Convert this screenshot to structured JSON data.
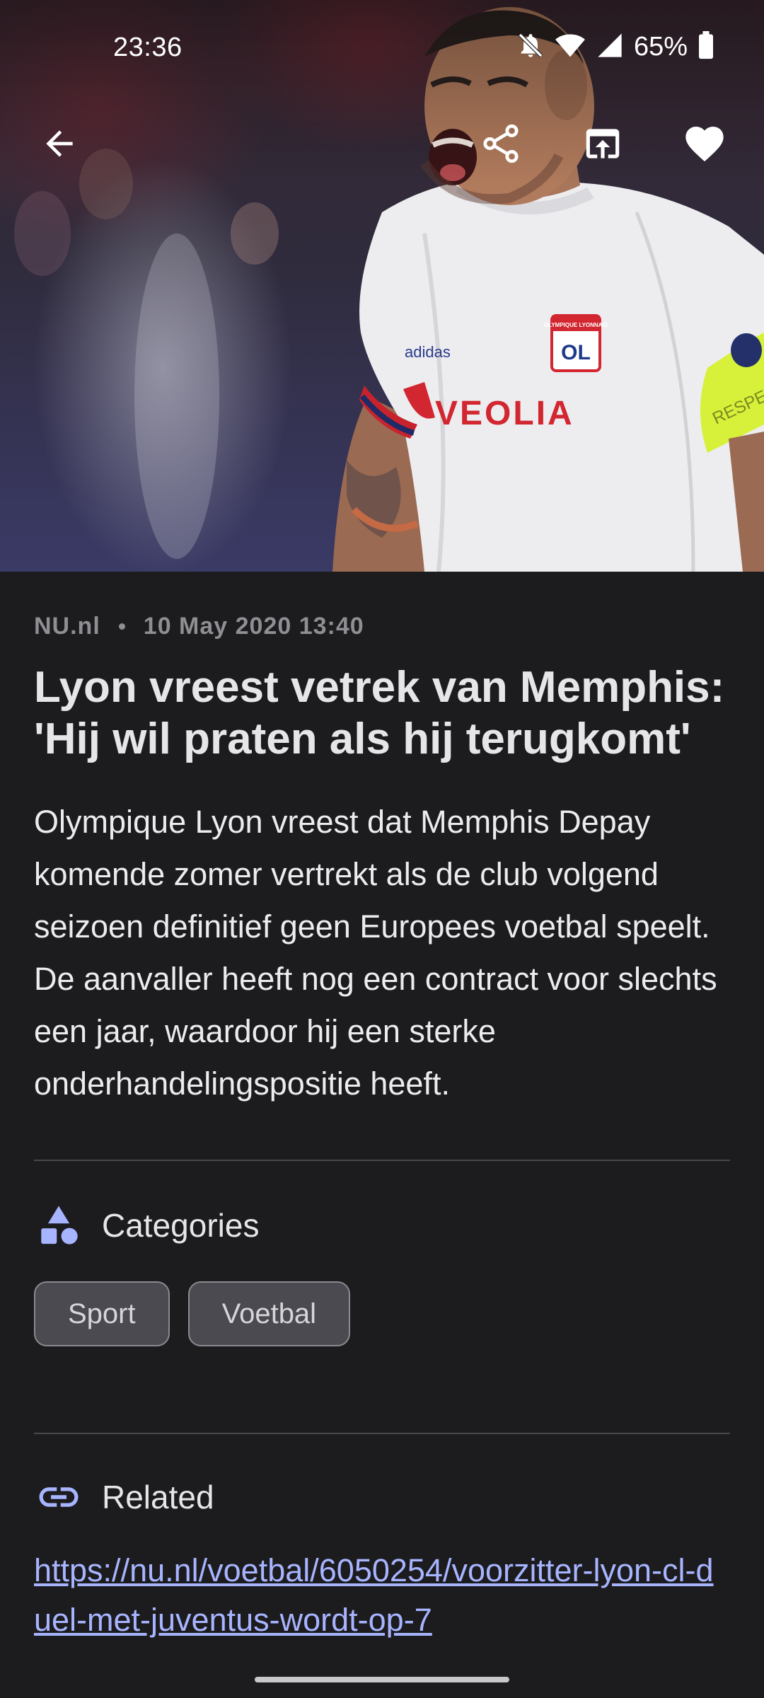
{
  "status_bar": {
    "time": "23:36",
    "battery": "65%",
    "icons": [
      "notifications-off-icon",
      "wifi-icon",
      "cell-signal-icon",
      "battery-icon"
    ]
  },
  "app_bar": {
    "back_icon": "arrow-left-icon",
    "actions": [
      "share-icon",
      "open-in-browser-icon",
      "favorite-heart-icon"
    ]
  },
  "hero": {
    "jersey_sponsor": "VEOLIA",
    "jersey_brand": "adidas",
    "crest_text": "OL",
    "crest_caption": "OLYMPIQUE LYONNAIS",
    "armband_text": "RESPECT"
  },
  "article": {
    "source": "NU.nl",
    "date": "10 May 2020 13:40",
    "title": "Lyon vreest vetrek van Memphis: 'Hij wil praten als hij terugkomt'",
    "summary": "Olympique Lyon vreest dat Memphis Depay komende zomer vertrekt als de club volgend seizoen definitief geen Europees voetbal speelt. De aanvaller heeft nog een contract voor slechts een jaar, waardoor hij een sterke onderhandelingspositie heeft."
  },
  "categories": {
    "heading": "Categories",
    "icon": "category-shapes-icon",
    "items": [
      "Sport",
      "Voetbal"
    ]
  },
  "related": {
    "heading": "Related",
    "icon": "link-icon",
    "link_text": "https://nu.nl/voetbal/6050254/voorzitter-lyon-cl-duel-met-juventus-wordt-op-7"
  },
  "colors": {
    "background": "#1c1c1e",
    "link": "#a7b4ff",
    "chip_bg": "#4a4a50",
    "accent_icon": "#a7b4ff"
  }
}
